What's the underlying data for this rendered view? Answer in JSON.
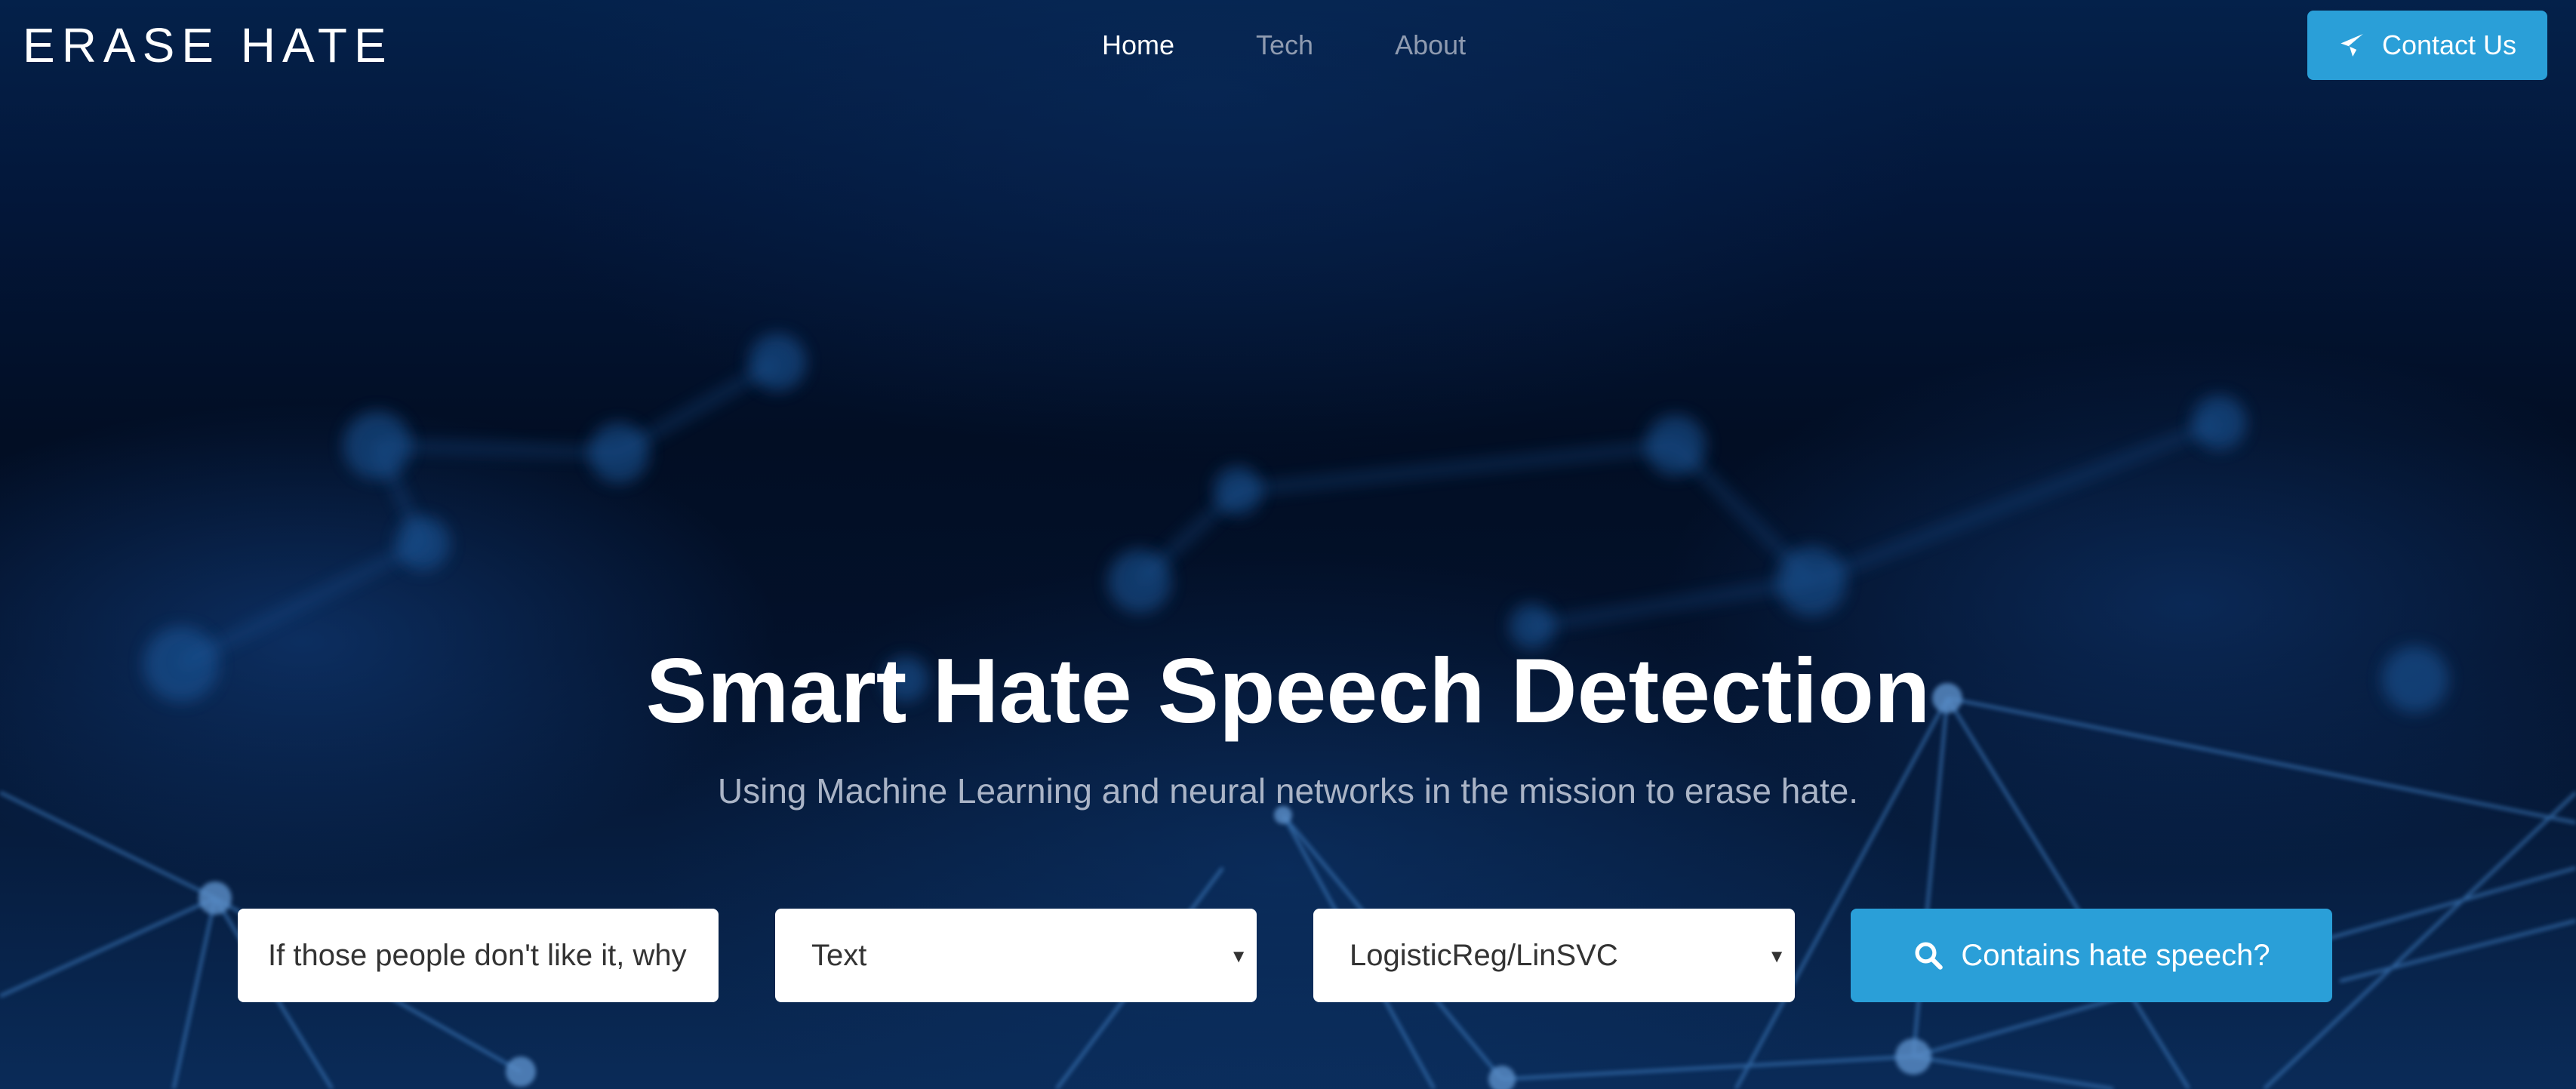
{
  "nav": {
    "brand": "ERASE HATE",
    "links": [
      {
        "label": "Home",
        "active": true
      },
      {
        "label": "Tech",
        "active": false
      },
      {
        "label": "About",
        "active": false
      }
    ],
    "contact_label": "Contact Us",
    "contact_icon": "paper-plane-icon"
  },
  "hero": {
    "title": "Smart Hate Speech Detection",
    "subtitle": "Using Machine Learning and neural networks in the mission to erase hate."
  },
  "form": {
    "text_input_value": "If those people don't like it, why",
    "type_select_value": "Text",
    "model_select_value": "LogisticReg/LinSVC",
    "submit_label": "Contains hate speech?",
    "submit_icon": "search-icon"
  },
  "colors": {
    "accent": "#2a9fd8",
    "background_dark": "#020b1c",
    "nav_inactive": "#8f9bb0"
  }
}
